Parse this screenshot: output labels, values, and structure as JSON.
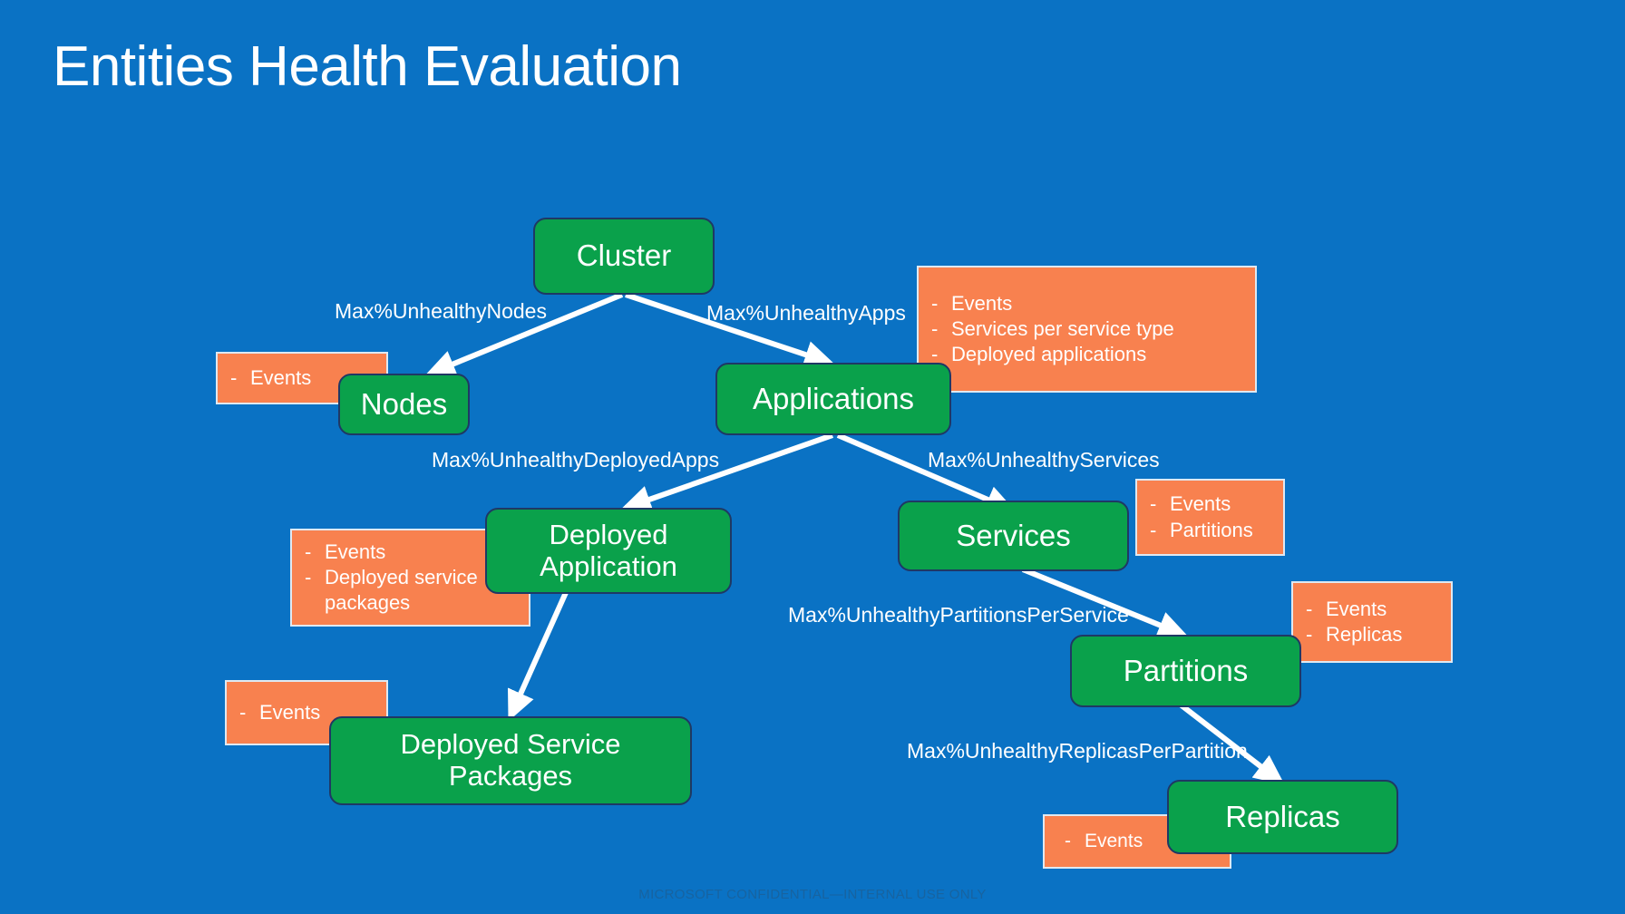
{
  "slide": {
    "title": "Entities Health Evaluation",
    "background_color": "#0a72c4",
    "node_color": "#0aa14b",
    "node_border_color": "#1f3864",
    "callout_color": "#f8814f",
    "callout_border_color": "#dfe9f2",
    "text_color": "#ffffff",
    "footer": "MICROSOFT CONFIDENTIAL—INTERNAL USE ONLY"
  },
  "nodes": [
    {
      "id": "cluster",
      "label": "Cluster"
    },
    {
      "id": "nodes",
      "label": "Nodes"
    },
    {
      "id": "apps",
      "label": "Applications"
    },
    {
      "id": "depapp",
      "label": "Deployed Application"
    },
    {
      "id": "services",
      "label": "Services"
    },
    {
      "id": "deppkg",
      "label": "Deployed Service Packages"
    },
    {
      "id": "partitions",
      "label": "Partitions"
    },
    {
      "id": "replicas",
      "label": "Replicas"
    }
  ],
  "edge_labels": [
    {
      "id": "e1",
      "label": "Max%UnhealthyNodes"
    },
    {
      "id": "e2",
      "label": "Max%UnhealthyApps"
    },
    {
      "id": "e3",
      "label": "Max%UnhealthyDeployedApps"
    },
    {
      "id": "e4",
      "label": "Max%UnhealthyServices"
    },
    {
      "id": "e5",
      "label": "Max%UnhealthyPartitionsPerService"
    },
    {
      "id": "e6",
      "label": "Max%UnhealthyReplicasPerPartition"
    }
  ],
  "callouts": [
    {
      "id": "c-nodes",
      "owner": "Nodes",
      "items": [
        "Events"
      ]
    },
    {
      "id": "c-apps",
      "owner": "Applications",
      "items": [
        "Events",
        "Services per service type",
        "Deployed applications"
      ]
    },
    {
      "id": "c-depapp",
      "owner": "Deployed Application",
      "items": [
        "Events",
        "Deployed service packages"
      ]
    },
    {
      "id": "c-deppkg",
      "owner": "Deployed Service Packages",
      "items": [
        "Events"
      ]
    },
    {
      "id": "c-services",
      "owner": "Services",
      "items": [
        "Events",
        "Partitions"
      ]
    },
    {
      "id": "c-parts",
      "owner": "Partitions",
      "items": [
        "Events",
        "Replicas"
      ]
    },
    {
      "id": "c-replicas",
      "owner": "Replicas",
      "items": [
        "Events"
      ]
    }
  ],
  "bullet_marker": "-"
}
